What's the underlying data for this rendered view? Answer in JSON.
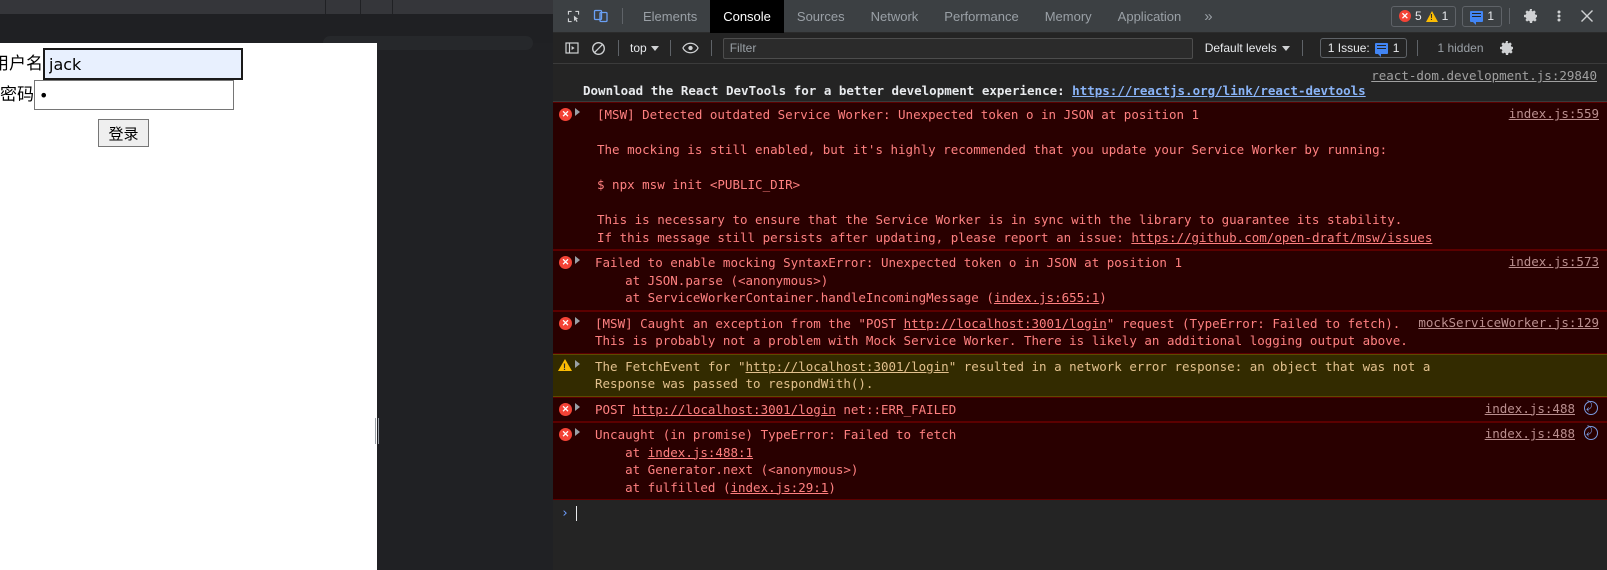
{
  "browser": {
    "page": {
      "username_label": "用户名",
      "username_value": "jack",
      "password_label": "密码",
      "password_value": "•",
      "login_button": "登录"
    }
  },
  "devtools": {
    "tabs": [
      {
        "label": "Elements",
        "active": false
      },
      {
        "label": "Console",
        "active": true
      },
      {
        "label": "Sources",
        "active": false
      },
      {
        "label": "Network",
        "active": false
      },
      {
        "label": "Performance",
        "active": false
      },
      {
        "label": "Memory",
        "active": false
      },
      {
        "label": "Application",
        "active": false
      }
    ],
    "more_tabs": "»",
    "inspect_icon": "inspect-element-icon",
    "device_toggle_icon": "device-toolbar-icon",
    "error_count": "5",
    "warning_count": "1",
    "message_count": "1",
    "settings_icon": "gear-icon",
    "more_options_icon": "kebab-menu-icon",
    "close_icon": "close-icon",
    "filterbar": {
      "sidebar_icon": "console-sidebar-icon",
      "clear_icon": "clear-console-icon",
      "context": "top",
      "eye_icon": "live-expression-icon",
      "filter_placeholder": "Filter",
      "filter_value": "",
      "levels": "Default levels",
      "issues_label": "1 Issue:",
      "issues_count": "1",
      "hidden": "1 hidden",
      "settings_icon": "console-settings-gear-icon"
    },
    "messages": [
      {
        "kind": "info",
        "source": "react-dom.development.js:29840",
        "text_before": "Download the React DevTools for a better development experience: ",
        "link": "https://reactjs.org/link/react-devtools",
        "text_after": ""
      },
      {
        "kind": "error",
        "badge": "x",
        "source": "index.js:559",
        "lines": [
          "[MSW] Detected outdated Service Worker: Unexpected token o in JSON at position 1",
          "",
          "The mocking is still enabled, but it's highly recommended that you update your Service Worker by running:",
          "",
          "$ npx msw init <PUBLIC_DIR>",
          "",
          "This is necessary to ensure that the Service Worker is in sync with the library to guarantee its stability.",
          "If this message still persists after updating, please report an issue: "
        ],
        "trailing_link": "https://github.com/open-draft/msw/issues"
      },
      {
        "kind": "error",
        "badge": "x",
        "source": "index.js:573",
        "lines": [
          "Failed to enable mocking SyntaxError: Unexpected token o in JSON at position 1",
          "    at JSON.parse (<anonymous>)",
          "    at ServiceWorkerContainer.handleIncomingMessage ("
        ],
        "trailing_link": "index.js:655:1",
        "trailing_after": ")"
      },
      {
        "kind": "error",
        "badge": "x",
        "source": "mockServiceWorker.js:129",
        "segments": [
          {
            "t": "[MSW] Caught an exception from the \"POST "
          },
          {
            "l": "http://localhost:3001/login"
          },
          {
            "t": "\" request (TypeError: Failed to fetch). This is probably not a problem with Mock Service Worker. There is likely an additional logging output above."
          }
        ]
      },
      {
        "kind": "warn",
        "badge": "!",
        "source": "",
        "segments": [
          {
            "t": "The FetchEvent for \""
          },
          {
            "l": "http://localhost:3001/login"
          },
          {
            "t": "\" resulted in a network error response: an object that was not a Response was passed to respondWith()."
          }
        ]
      },
      {
        "kind": "error",
        "badge": "x",
        "source": "index.js:488",
        "has_network_icon": true,
        "segments": [
          {
            "t": "POST "
          },
          {
            "l": "http://localhost:3001/login"
          },
          {
            "t": " net::ERR_FAILED"
          }
        ]
      },
      {
        "kind": "error",
        "badge": "x",
        "source": "index.js:488",
        "has_network_icon": true,
        "segments": [
          {
            "t": "Uncaught (in promise) TypeError: Failed to fetch\n    at "
          },
          {
            "l": "index.js:488:1"
          },
          {
            "t": "\n    at Generator.next (<anonymous>)\n    at fulfilled ("
          },
          {
            "l": "index.js:29:1"
          },
          {
            "t": ")"
          }
        ]
      }
    ],
    "prompt": {
      "caret": "›",
      "value": ""
    }
  },
  "colors": {
    "accent": "#4285f4",
    "error": "#f44336",
    "warning": "#fbbc04",
    "link": "#8ab4f8",
    "autofill": "#e8f0fe"
  }
}
